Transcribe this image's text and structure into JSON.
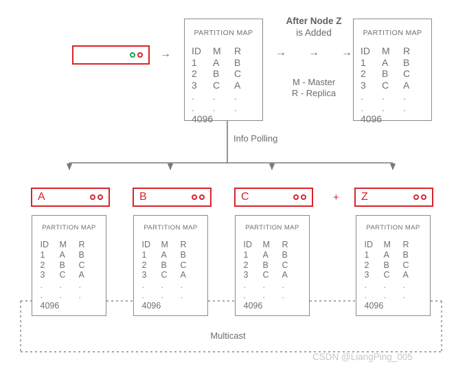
{
  "diagram": {
    "title_bold": "After Node Z",
    "title_regular": "is Added",
    "legend_master": "M - Master",
    "legend_replica": "R - Replica",
    "info_polling": "Info Polling",
    "multicast": "Multicast",
    "plus": "+",
    "watermark": "CSDN @LiangPing_005",
    "colors": {
      "node_red": "#d9222a",
      "status_green": "#1f9e4a",
      "box_gray": "#8a8a8a",
      "text_gray": "#6b6b6b",
      "background": "#ffffff"
    }
  },
  "client": {
    "name": "client-box",
    "dots": [
      "green",
      "red"
    ]
  },
  "partition_map": {
    "title": "PARTITION MAP",
    "headers": [
      "ID",
      "M",
      "R"
    ],
    "rows": [
      [
        "1",
        "A",
        "B"
      ],
      [
        "2",
        "B",
        "C"
      ],
      [
        "3",
        "C",
        "A"
      ],
      [
        ".",
        ".",
        "."
      ],
      [
        ".",
        ".",
        "."
      ]
    ],
    "total": "4096"
  },
  "top_maps": [
    {
      "id": "map-before",
      "label": "PARTITION MAP"
    },
    {
      "id": "map-after",
      "label": "PARTITION MAP"
    }
  ],
  "arrows": {
    "client_to_map": "→",
    "transition": [
      "→",
      "→",
      "→"
    ]
  },
  "nodes": [
    {
      "label": "A",
      "dots": [
        "red",
        "red"
      ]
    },
    {
      "label": "B",
      "dots": [
        "red",
        "red"
      ]
    },
    {
      "label": "C",
      "dots": [
        "red",
        "red"
      ]
    },
    {
      "label": "Z",
      "dots": [
        "red",
        "red"
      ]
    }
  ]
}
